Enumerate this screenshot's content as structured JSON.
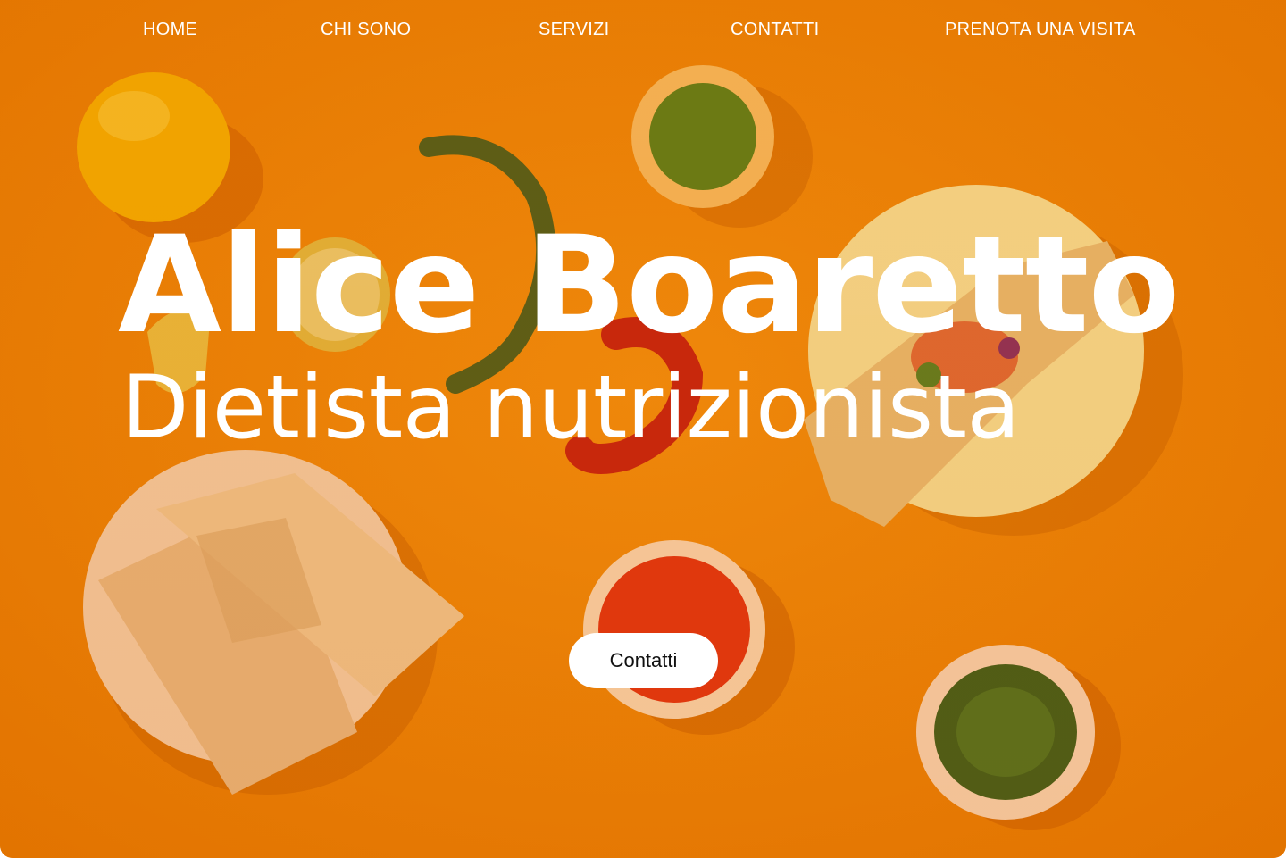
{
  "nav": {
    "home": "HOME",
    "about": "CHI SONO",
    "services": "SERVIZI",
    "contacts": "CONTATTI",
    "book": "PRENOTA UNA VISITA"
  },
  "hero": {
    "name": "Alice Boaretto",
    "role": "Dietista nutrizionista",
    "cta_label": "Contatti"
  },
  "colors": {
    "background": "#ea8106",
    "text": "#ffffff",
    "button_bg": "#ffffff",
    "button_text": "#111111"
  },
  "background_image": {
    "subject": "overhead flat-lay of tamales, chili peppers, lemon, lime and salsas on an orange surface"
  }
}
